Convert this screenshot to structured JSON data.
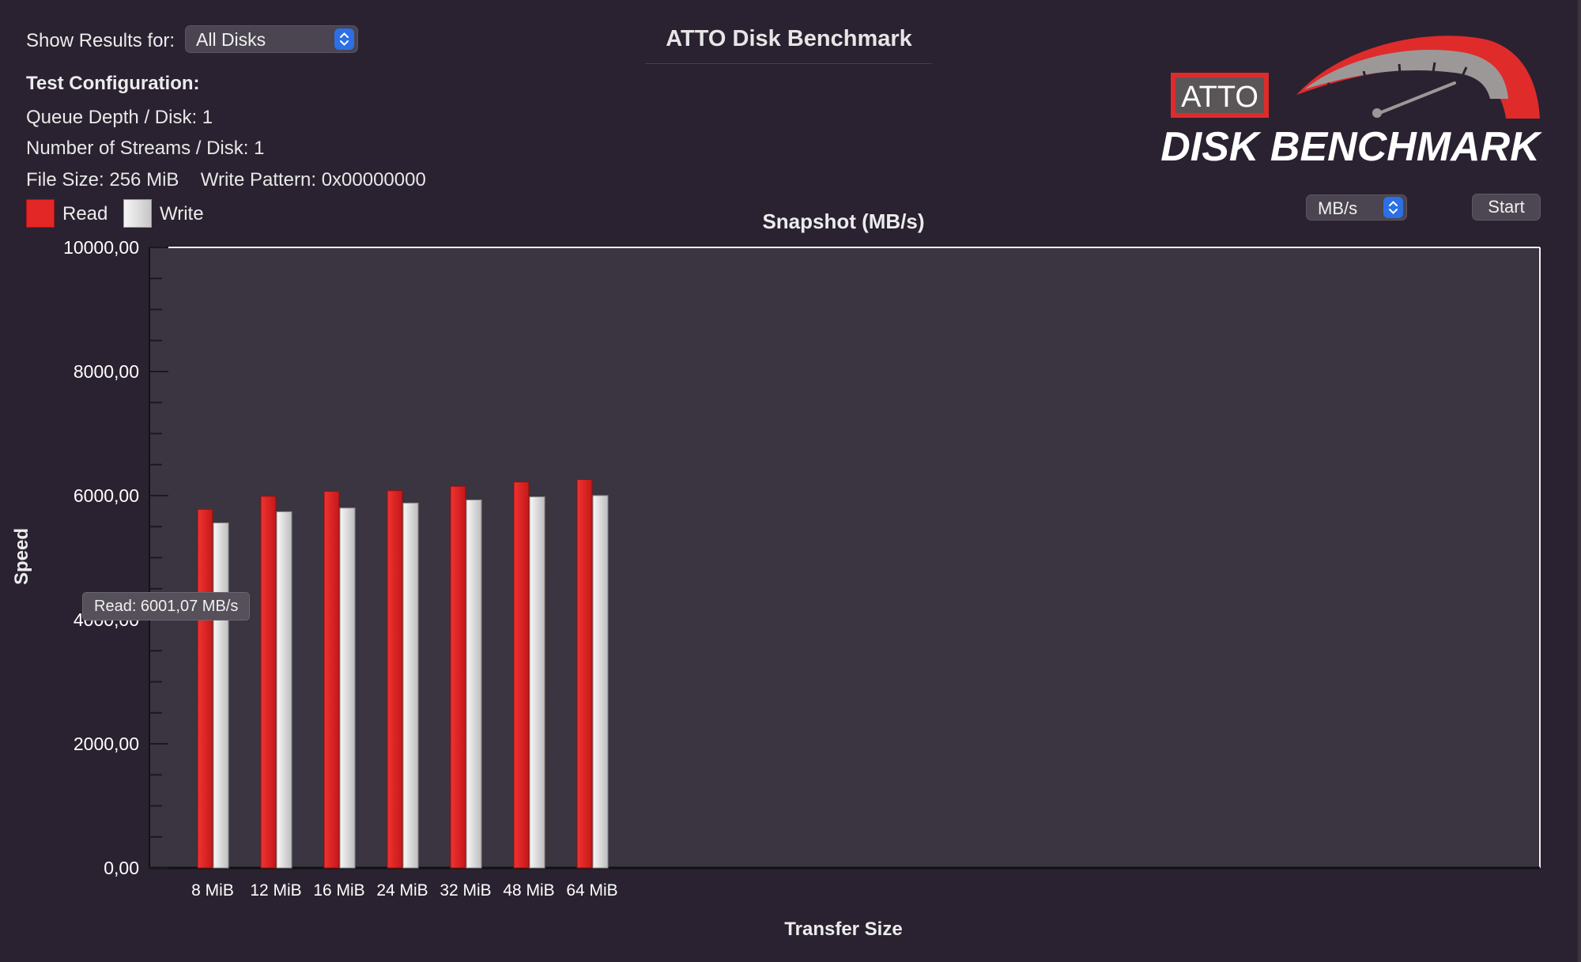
{
  "app": {
    "title": "ATTO Disk Benchmark"
  },
  "controls": {
    "show_results_label": "Show Results for:",
    "disk_selected": "All Disks",
    "unit_selected": "MB/s",
    "start_label": "Start"
  },
  "config": {
    "heading": "Test Configuration:",
    "queue_depth": "Queue Depth / Disk: 1",
    "streams": "Number of Streams / Disk: 1",
    "file_size": "File Size: 256 MiB",
    "write_pattern": "Write Pattern: 0x00000000"
  },
  "logo": {
    "badge_text": "ATTO",
    "wordmark": "DISK BENCHMARK"
  },
  "legend": {
    "read": "Read",
    "write": "Write"
  },
  "tooltip": {
    "text": "Read: 6001,07 MB/s"
  },
  "colors": {
    "background": "#2a2230",
    "plot_background": "#3a3540",
    "read": "#e32626",
    "write": "#e0e0e0",
    "accent": "#2d6fe6"
  },
  "chart_data": {
    "type": "bar",
    "title": "Snapshot (MB/s)",
    "xlabel": "Transfer Size",
    "ylabel": "Speed",
    "ylim": [
      0,
      10000
    ],
    "y_ticks": [
      0,
      2000,
      4000,
      6000,
      8000,
      10000
    ],
    "y_tick_labels": [
      "0,00",
      "2000,00",
      "4000,00",
      "6000,00",
      "8000,00",
      "10000,00"
    ],
    "categories": [
      "8 MiB",
      "12 MiB",
      "16 MiB",
      "24 MiB",
      "32 MiB",
      "48 MiB",
      "64 MiB"
    ],
    "series": [
      {
        "name": "Read",
        "values": [
          5780,
          5990,
          6070,
          6080,
          6150,
          6220,
          6260
        ]
      },
      {
        "name": "Write",
        "values": [
          5560,
          5740,
          5800,
          5880,
          5930,
          5980,
          6001
        ]
      }
    ],
    "grid": false,
    "legend": "top-left"
  }
}
